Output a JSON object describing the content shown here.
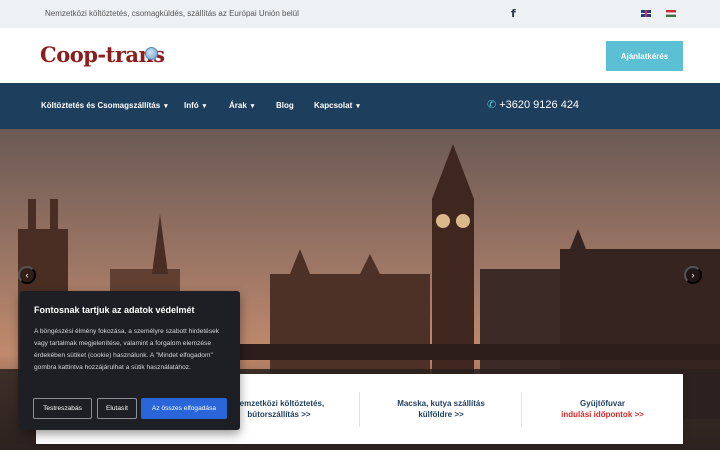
{
  "topbar": {
    "text": "Nemzetközi költöztetés, csomagküldés, szállítás az Európai Unión belül",
    "facebook": "f"
  },
  "header": {
    "logo": "Coop-trans",
    "cta": "Ajánlatkérés"
  },
  "nav": {
    "items": [
      {
        "label": "Költöztetés és Csomagszállítás",
        "dropdown": true
      },
      {
        "label": "Infó",
        "dropdown": true
      },
      {
        "label": "Árak",
        "dropdown": true
      },
      {
        "label": "Blog",
        "dropdown": false
      },
      {
        "label": "Kapcsolat",
        "dropdown": true
      }
    ],
    "phone": "+3620 9126 424"
  },
  "hero": {
    "prev": "‹",
    "next": "›"
  },
  "cards": [
    {
      "line1": "Nemzetközi költöztetés,",
      "line2": "bútorszállítás >>"
    },
    {
      "line1": "Macska, kutya szállítás",
      "line2": "külföldre >>"
    },
    {
      "line1": "Gyüjtőfuvar",
      "line2": "indulási időpontok >>"
    }
  ],
  "cookie": {
    "title": "Fontosnak tartjuk az adatok védelmét",
    "body": "A böngészési élmény fokozása, a személyre szabott hirdetések vagy tartalmak megjelenítése, valamint a forgalom elemzése érdekében sütiket (cookie) használunk. A \"Mindet elfogadom\" gombra kattintva hozzájárulhat a sütik használatához.",
    "customize": "Testreszabás",
    "reject": "Elutasít",
    "accept": "Az összes elfogadása"
  },
  "colors": {
    "nav": "#1d3e5c",
    "cta": "#5bc0d3",
    "logo": "#8b1d1d",
    "accept": "#2a66d9",
    "link_red": "#d62828"
  }
}
